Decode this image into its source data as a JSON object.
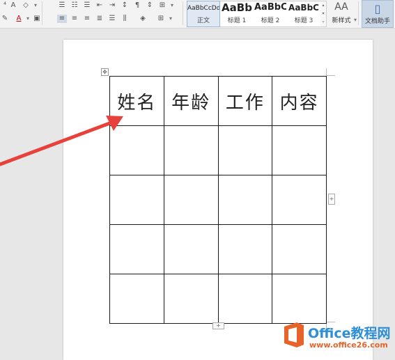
{
  "ribbon": {
    "font_icons": [
      "A",
      "A"
    ],
    "styles": [
      {
        "sample": "AaBbCcDd",
        "name": "正文",
        "active": true
      },
      {
        "sample": "AaBb",
        "name": "标题 1",
        "active": false
      },
      {
        "sample": "AaBbC",
        "name": "标题 2",
        "active": false
      },
      {
        "sample": "AaBbC",
        "name": "标题 3",
        "active": false
      }
    ],
    "new_style_icon": "AA",
    "new_style_label": "新样式",
    "assistant_label": "文档助手"
  },
  "table": {
    "headers": [
      "姓名",
      "年龄",
      "工作",
      "内容"
    ],
    "rows": [
      [
        "",
        "",
        "",
        ""
      ],
      [
        "",
        "",
        "",
        ""
      ],
      [
        "",
        "",
        "",
        ""
      ],
      [
        "",
        "",
        "",
        ""
      ]
    ]
  },
  "annotation": {
    "arrow_color": "#e8413c"
  },
  "watermark": {
    "title": "Office教程网",
    "url": "www.office26.com",
    "colors": {
      "title": "#2e8fd6",
      "url": "#e8632a",
      "logo": "#e8632a"
    }
  }
}
